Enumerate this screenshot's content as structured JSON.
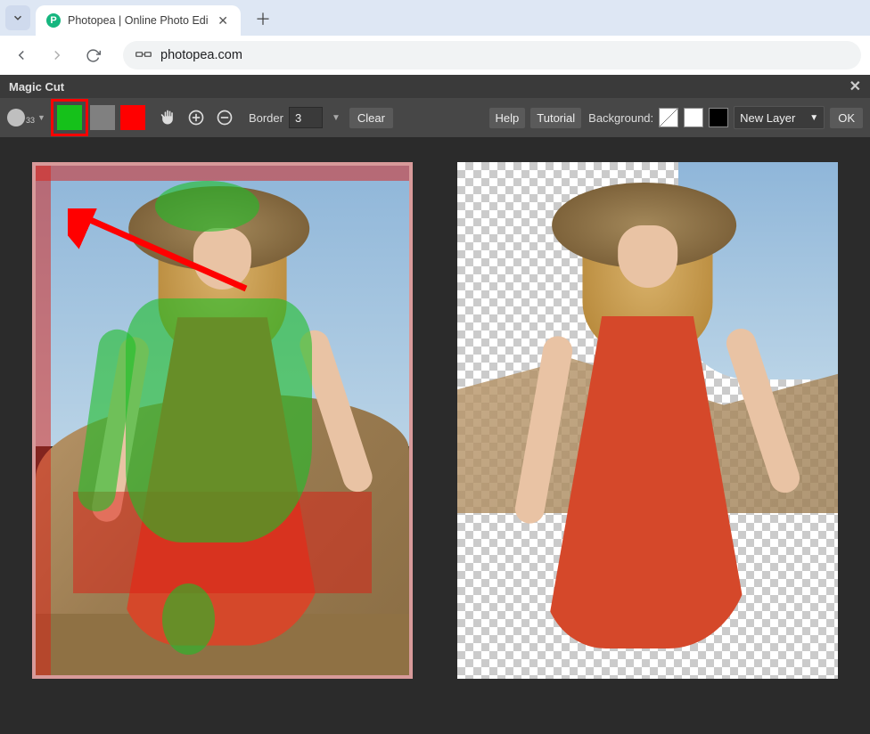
{
  "browser": {
    "tab_title": "Photopea | Online Photo Edi",
    "url": "photopea.com"
  },
  "panel": {
    "title": "Magic Cut",
    "brush_size": "33",
    "colors": {
      "foreground": "#15c11a",
      "neutral": "#808080",
      "background": "#ff0000"
    },
    "border_label": "Border",
    "border_value": "3",
    "clear_label": "Clear",
    "help_label": "Help",
    "tutorial_label": "Tutorial",
    "background_label": "Background:",
    "layer_select": "New Layer",
    "ok_label": "OK"
  }
}
